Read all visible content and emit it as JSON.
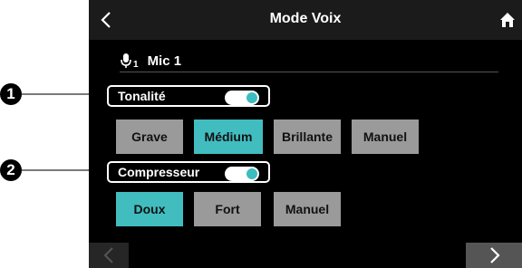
{
  "header": {
    "title": "Mode Voix"
  },
  "channel": {
    "subscript": "1",
    "name": "Mic 1"
  },
  "sections": [
    {
      "number": "1",
      "label": "Tonalité",
      "toggle": true,
      "options": [
        "Grave",
        "Médium",
        "Brillante",
        "Manuel"
      ],
      "selected": "Médium"
    },
    {
      "number": "2",
      "label": "Compresseur",
      "toggle": true,
      "options": [
        "Doux",
        "Fort",
        "Manuel"
      ],
      "selected": "Doux"
    }
  ],
  "colors": {
    "accent": "#41bdc0",
    "button": "#9a9a9a",
    "background": "#000000"
  },
  "icons": {
    "back": "chevron-left-icon",
    "home": "home-icon",
    "mic": "microphone-icon",
    "prev": "chevron-left-icon",
    "next": "chevron-right-icon"
  }
}
